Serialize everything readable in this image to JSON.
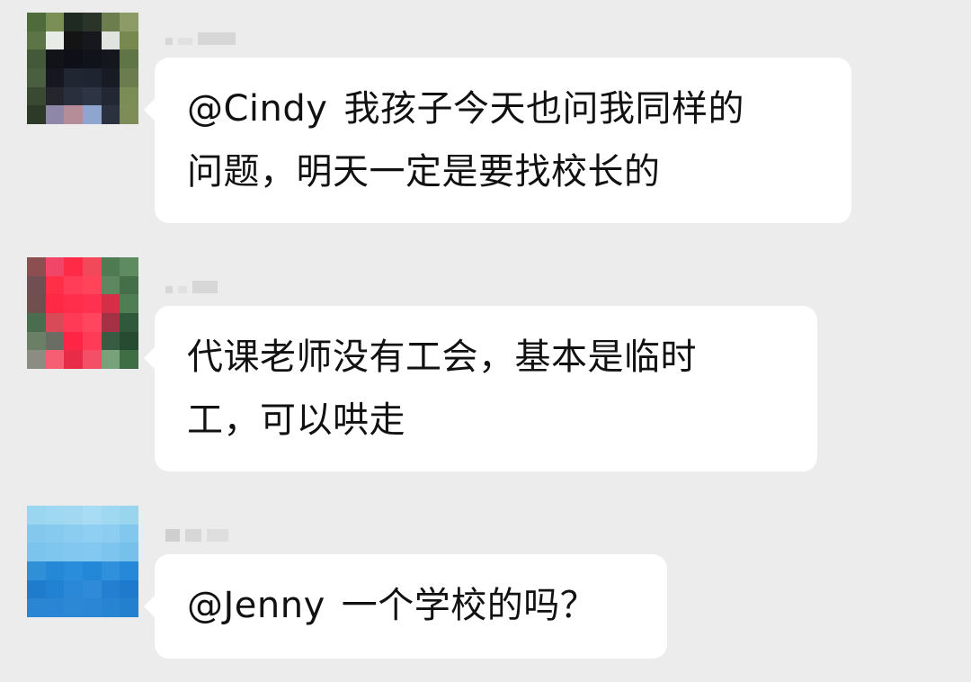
{
  "messages": [
    {
      "mention": "@Cindy",
      "lines": [
        "我孩子今天也问我同样的",
        "问题，明天一定是要找校长的"
      ]
    },
    {
      "lines": [
        "代课老师没有工会，基本是临时",
        "工，可以哄走"
      ]
    },
    {
      "mention": "@Jenny",
      "lines": [
        "一个学校的吗？"
      ]
    }
  ],
  "colors": {
    "background": "#ececec",
    "bubble": "#ffffff",
    "text": "#111111"
  }
}
